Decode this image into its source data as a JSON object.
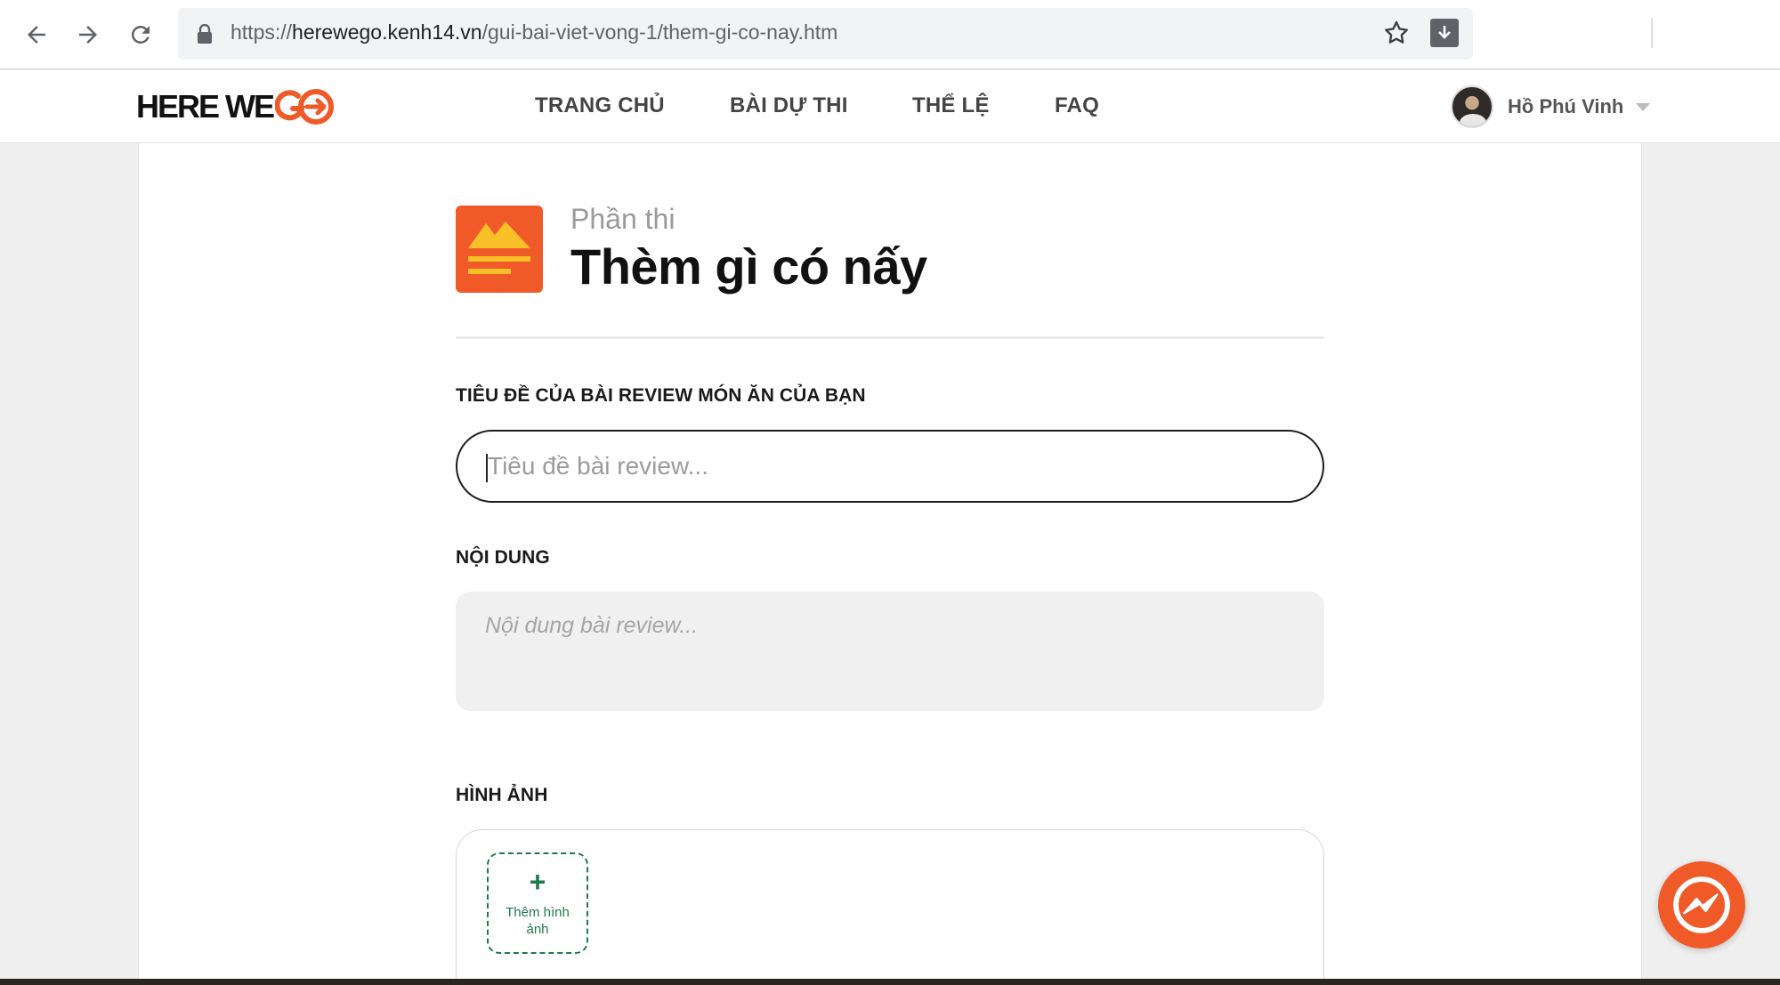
{
  "browser": {
    "url_prefix": "https://",
    "url_host": "herewego.kenh14.vn",
    "url_path": "/gui-bai-viet-vong-1/them-gi-co-nay.htm"
  },
  "header": {
    "logo_text": "HERE WE",
    "logo_go": "GO",
    "nav": [
      "TRANG CHỦ",
      "BÀI DỰ THI",
      "THỂ LỆ",
      "FAQ"
    ],
    "user_name": "Hồ Phú Vinh"
  },
  "section": {
    "eyebrow": "Phần thi",
    "title": "Thèm gì có nấy"
  },
  "form": {
    "title_label": "TIÊU ĐỀ CỦA BÀI REVIEW MÓN ĂN CỦA BẠN",
    "title_placeholder": "Tiêu đề bài review...",
    "title_value": "",
    "content_label": "NỘI DUNG",
    "content_placeholder": "Nội dung bài review...",
    "content_value": "",
    "images_label": "HÌNH ẢNH",
    "add_image_plus": "+",
    "add_image_label": "Thêm hình ảnh"
  },
  "colors": {
    "brand": "#f05a28",
    "add_image": "#1f7a4a"
  },
  "icons": [
    "back-arrow-icon",
    "forward-arrow-icon",
    "reload-icon",
    "lock-icon",
    "bookmark-star-icon",
    "download-icon",
    "chevron-down-icon",
    "messenger-icon"
  ]
}
